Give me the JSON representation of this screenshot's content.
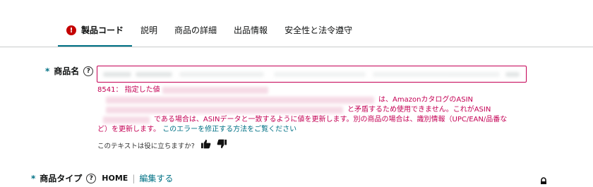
{
  "tabs": [
    {
      "label": "製品コード",
      "active": true,
      "error": true
    },
    {
      "label": "説明"
    },
    {
      "label": "商品の詳細"
    },
    {
      "label": "出品情報"
    },
    {
      "label": "安全性と法令遵守"
    }
  ],
  "error_icon_glyph": "!",
  "help_glyph": "?",
  "required_mark": "*",
  "product_name": {
    "label": "商品名",
    "field_value": ""
  },
  "error": {
    "line1": "8541： 指定した値",
    "line2": "は、AmazonカタログのASIN",
    "line3": "と矛盾するため使用できません。これがASIN",
    "line4": "である場合は、ASINデータと一致するように値を更新します。別の商品の場合は、識別情報（UPC/EAN/品番な",
    "line5": "ど）を更新します。",
    "link": "このエラーを修正する方法をご覧ください"
  },
  "feedback": {
    "question": "このテキストは役に立ちますか?"
  },
  "product_type": {
    "label": "商品タイプ",
    "value": "HOME",
    "separator": "|",
    "edit_link": "編集する"
  },
  "colors": {
    "accent": "#007185",
    "error": "#c40054",
    "error_icon": "#c40000"
  }
}
